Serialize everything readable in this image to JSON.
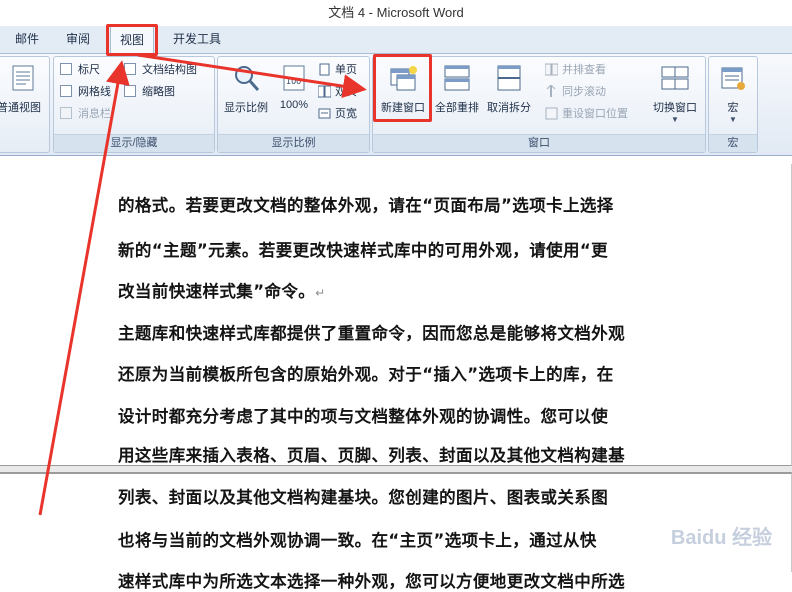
{
  "window": {
    "title": "文档 4 - Microsoft Word"
  },
  "tabs": [
    {
      "label": "邮件"
    },
    {
      "label": "审阅"
    },
    {
      "label": "视图",
      "active": true
    },
    {
      "label": "开发工具"
    }
  ],
  "ribbon": {
    "views_group": {
      "normal_view": "普通视图"
    },
    "show_hide_group": {
      "label": "显示/隐藏",
      "ruler": "标尺",
      "gridlines": "网格线",
      "message_bar": "消息栏",
      "document_map": "文档结构图",
      "thumbnails": "缩略图"
    },
    "zoom_group": {
      "label": "显示比例",
      "zoom": "显示比例",
      "hundred_percent": "100%",
      "one_page": "单页",
      "two_pages": "双页",
      "page_width": "页宽"
    },
    "window_group": {
      "label": "窗口",
      "new_window": "新建窗口",
      "arrange_all": "全部重排",
      "remove_split": "取消拆分",
      "view_side_by_side": "并排查看",
      "sync_scrolling": "同步滚动",
      "reset_window_position": "重设窗口位置",
      "switch_windows": "切换窗口"
    },
    "macros_group": {
      "label": "宏",
      "macros": "宏"
    }
  },
  "document": {
    "page1_lines": [
      "的格式。若要更改文档的整体外观，请在“页面布局”选项卡上选择",
      "新的“主题”元素。若要更改快速样式库中的可用外观，请使用“更",
      "改当前快速样式集”命令。",
      "主题库和快速样式库都提供了重置命令，因而您总是能够将文档外观",
      "还原为当前模板所包含的原始外观。对于“插入”选项卡上的库，在",
      "设计时都充分考虑了其中的项与文档整体外观的协调性。您可以使",
      "用这些库来插入表格、页眉、页脚、列表、封面以及其他文档构建基"
    ],
    "paragraph_mark": "↵",
    "page2_lines": [
      "列表、封面以及其他文档构建基块。您创建的图片、图表或关系图",
      "也将与当前的文档外观协调一致。在“主页”选项卡上，通过从快",
      "速样式库中为所选文本选择一种外观，您可以方便地更改文档中所选"
    ]
  },
  "watermark": "Baidu 经验",
  "colors": {
    "annotation": "#e8342b",
    "ribbon_text": "#1e2f48"
  }
}
